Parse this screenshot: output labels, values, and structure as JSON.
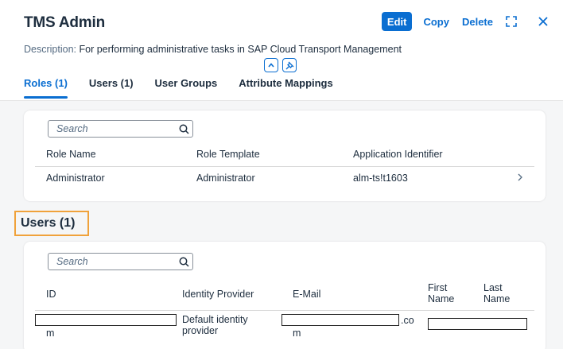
{
  "header": {
    "title": "TMS Admin",
    "actions": {
      "edit": "Edit",
      "copy": "Copy",
      "delete": "Delete"
    },
    "description_label": "Description:",
    "description": "For performing administrative tasks in SAP Cloud Transport Management"
  },
  "tabs": [
    {
      "label": "Roles (1)",
      "active": true
    },
    {
      "label": "Users (1)",
      "active": false
    },
    {
      "label": "User Groups",
      "active": false
    },
    {
      "label": "Attribute Mappings",
      "active": false
    }
  ],
  "roles": {
    "search_placeholder": "Search",
    "columns": [
      "Role Name",
      "Role Template",
      "Application Identifier"
    ],
    "rows": [
      {
        "role_name": "Administrator",
        "role_template": "Administrator",
        "app_id": "alm-ts!t1603"
      }
    ]
  },
  "users": {
    "section_title": "Users (1)",
    "search_placeholder": "Search",
    "columns": [
      "ID",
      "Identity Provider",
      "E-Mail",
      "First Name",
      "Last Name"
    ],
    "rows": [
      {
        "id_tail": "m",
        "identity_provider": "Default identity provider",
        "email_tail": ".co",
        "email_tail2": "m"
      }
    ]
  },
  "colors": {
    "accent": "#0a6ed1",
    "highlight_border": "#f0a23b",
    "background": "#f5f6f7"
  }
}
